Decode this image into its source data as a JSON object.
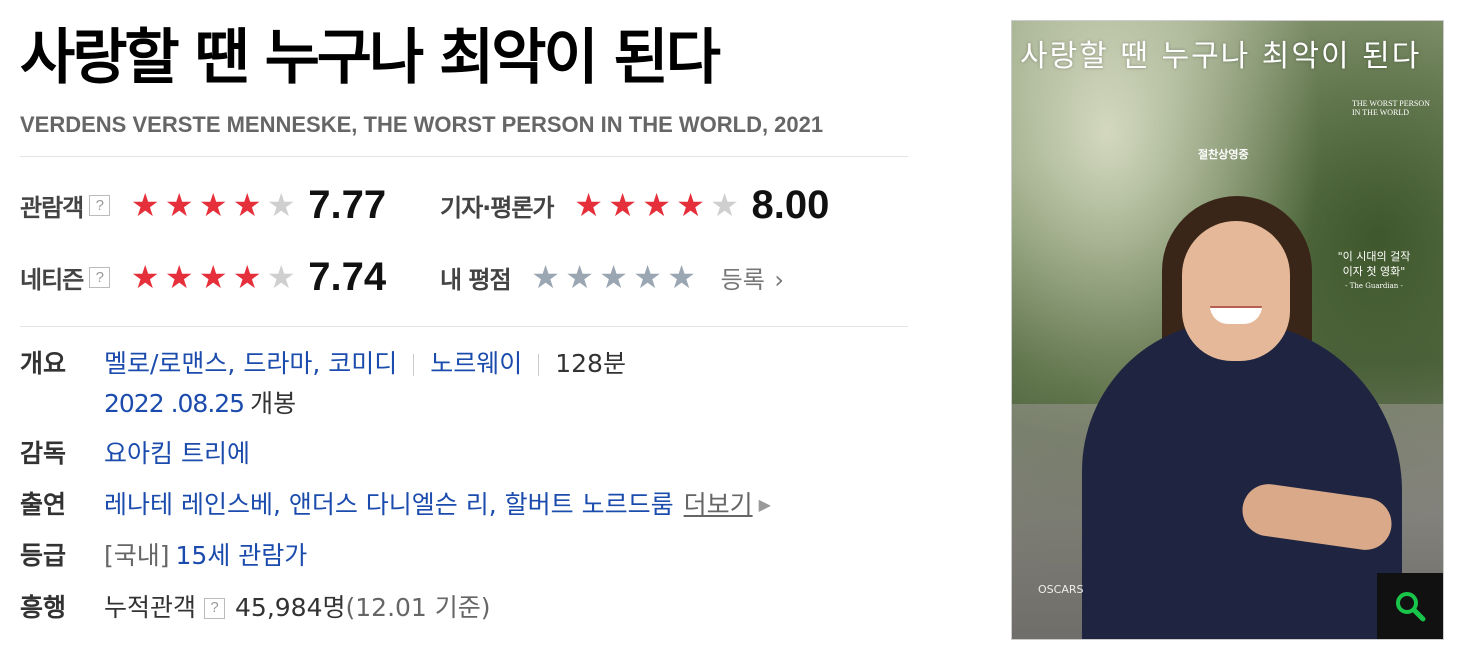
{
  "movie": {
    "title": "사랑할 땐 누구나 최악이 된다",
    "original_title": "VERDENS VERSTE MENNESKE, THE WORST PERSON IN THE WORLD, 2021"
  },
  "ratings": {
    "audience": {
      "label": "관람객",
      "help": "?",
      "score": "7.77",
      "stars_filled": 4
    },
    "critics": {
      "label": "기자·평론가",
      "score": "8.00",
      "stars_filled": 4
    },
    "netizen": {
      "label": "네티즌",
      "help": "?",
      "score": "7.74",
      "stars_filled": 4
    },
    "mine": {
      "label": "내 평점",
      "stars_filled": 0,
      "register_label": "등록"
    },
    "max_stars": 5
  },
  "info": {
    "overview_key": "개요",
    "genres": "멜로/로맨스, 드라마, 코미디",
    "country": "노르웨이",
    "runtime": "128분",
    "release_date": "2022 .08.25",
    "release_suffix": "개봉",
    "director_key": "감독",
    "director": "요아킴 트리에",
    "cast_key": "출연",
    "cast": "레나테 레인스베, 앤더스 다니엘슨 리, 할버트 노르드룸",
    "more_label": "더보기",
    "grade_key": "등급",
    "grade_prefix": "[국내]",
    "grade": "15세 관람가",
    "boxoffice_key": "흥행",
    "boxoffice_label": "누적관객",
    "boxoffice_help": "?",
    "boxoffice_count": "45,984명",
    "boxoffice_basis": "(12.01 기준)"
  },
  "poster": {
    "title_text": "사랑할 땐 누구나 최악이 된다",
    "english_text": "THE WORST PERSON IN THE WORLD",
    "open_text": "절찬상영중",
    "quote": "\"이 시대의 걸작이자 첫 영화\"",
    "quote_source": "- The Guardian -",
    "oscars_text": "OSCARS"
  },
  "colors": {
    "accent_star": "#e5303b",
    "link": "#1b4cad",
    "zoom_icon": "#19c44a"
  },
  "icons": {
    "zoom": "search-icon",
    "help": "help-icon",
    "more_arrow": "caret-right-icon",
    "register_arrow": "chevron-right-icon"
  }
}
